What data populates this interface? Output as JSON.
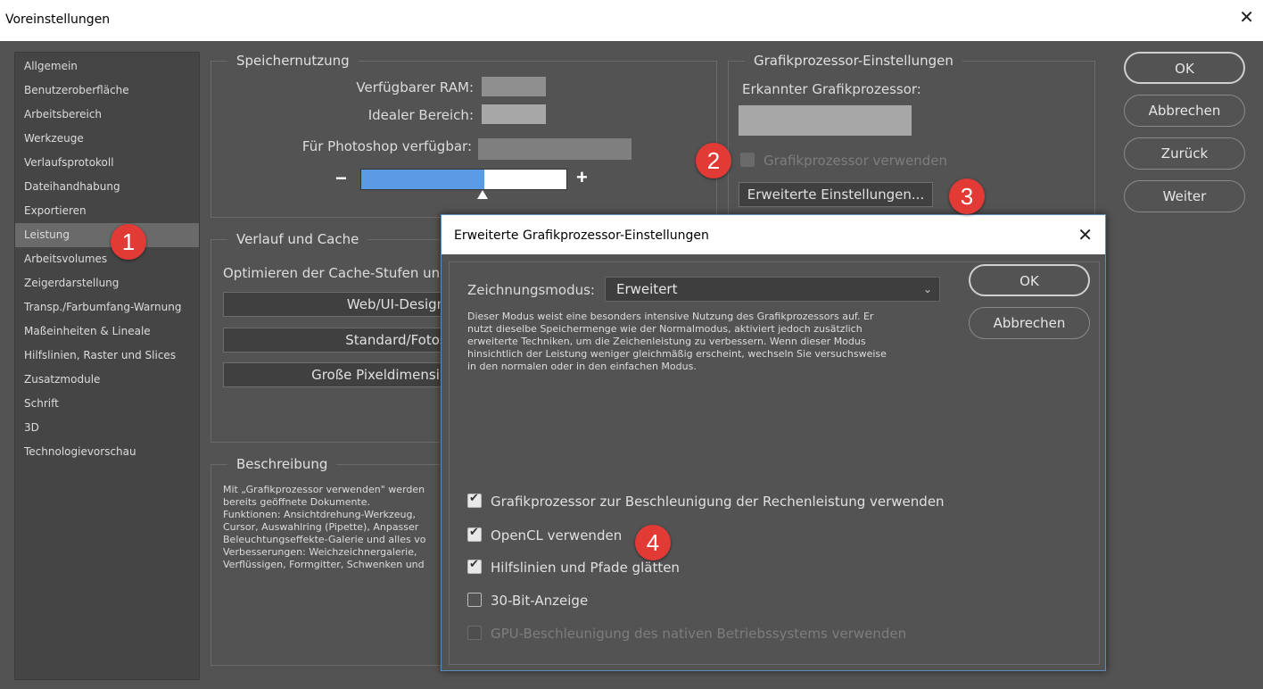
{
  "window": {
    "title": "Voreinstellungen",
    "close": "✕"
  },
  "sidebar": {
    "items": [
      {
        "label": "Allgemein"
      },
      {
        "label": "Benutzeroberfläche"
      },
      {
        "label": "Arbeitsbereich"
      },
      {
        "label": "Werkzeuge"
      },
      {
        "label": "Verlaufsprotokoll"
      },
      {
        "label": "Dateihandhabung"
      },
      {
        "label": "Exportieren"
      },
      {
        "label": "Leistung"
      },
      {
        "label": "Arbeitsvolumes"
      },
      {
        "label": "Zeigerdarstellung"
      },
      {
        "label": "Transp./Farbumfang-Warnung"
      },
      {
        "label": "Maßeinheiten & Lineale"
      },
      {
        "label": "Hilfslinien, Raster und Slices"
      },
      {
        "label": "Zusatzmodule"
      },
      {
        "label": "Schrift"
      },
      {
        "label": "3D"
      },
      {
        "label": "Technologievorschau"
      }
    ],
    "active": "Leistung"
  },
  "memory": {
    "legend": "Speichernutzung",
    "ram_label": "Verfügbarer RAM:",
    "ideal_label": "Idealer Bereich:",
    "available_label": "Für Photoshop verfügbar:",
    "minus": "−",
    "plus": "+",
    "slider_fraction": 0.6
  },
  "gpu": {
    "legend": "Grafikprozessor-Einstellungen",
    "detected_label": "Erkannter Grafikprozessor:",
    "use_gpu_label": "Grafikprozessor verwenden",
    "advanced_button": "Erweiterte Einstellungen..."
  },
  "cache": {
    "legend": "Verlauf und Cache",
    "optimize_label": "Optimieren der Cache-Stufen un",
    "buttons": [
      "Web/UI-Design",
      "Standard/Fotos",
      "Große Pixeldimensi"
    ]
  },
  "description": {
    "legend": "Beschreibung",
    "lines": [
      "Mit „Grafikprozessor verwenden\" werden",
      "bereits geöffnete Dokumente.",
      "Funktionen: Ansichtdrehung-Werkzeug,",
      "Cursor, Auswahlring (Pipette), Anpasser",
      "Beleuchtungseffekte-Galerie und alles vo",
      "Verbesserungen: Weichzeichnergalerie,",
      "Verflüssigen, Formgitter, Schwenken und"
    ]
  },
  "actions": {
    "ok": "OK",
    "cancel": "Abbrechen",
    "back": "Zurück",
    "next": "Weiter"
  },
  "badges": [
    "1",
    "2",
    "3",
    "4"
  ],
  "subdialog": {
    "title": "Erweiterte Grafikprozessor-Einstellungen",
    "close": "✕",
    "mode_label": "Zeichnungsmodus:",
    "mode_value": "Erweitert",
    "chevron": "⌄",
    "mode_description": [
      "Dieser Modus weist eine besonders intensive Nutzung des Grafikprozessors auf. Er",
      "nutzt dieselbe Speichermenge wie der Normalmodus, aktiviert jedoch zusätzlich",
      "erweiterte Techniken, um die Zeichenleistung zu verbessern. Wenn dieser Modus",
      "hinsichtlich der Leistung weniger gleichmäßig erscheint, wechseln Sie versuchsweise",
      "in den normalen oder in den einfachen Modus."
    ],
    "ok": "OK",
    "cancel": "Abbrechen",
    "options": [
      {
        "label": "Grafikprozessor zur Beschleunigung der Rechenleistung verwenden",
        "checked": true,
        "disabled": false
      },
      {
        "label": "OpenCL verwenden",
        "checked": true,
        "disabled": false
      },
      {
        "label": "Hilfslinien und Pfade glätten",
        "checked": true,
        "disabled": false
      },
      {
        "label": "30-Bit-Anzeige",
        "checked": false,
        "disabled": false
      },
      {
        "label": "GPU-Beschleunigung des nativen Betriebssystems verwenden",
        "checked": false,
        "disabled": true
      }
    ]
  },
  "colors": {
    "background": "#535353",
    "slider_fill": "#5b9be6",
    "badge": "#e23b35"
  }
}
